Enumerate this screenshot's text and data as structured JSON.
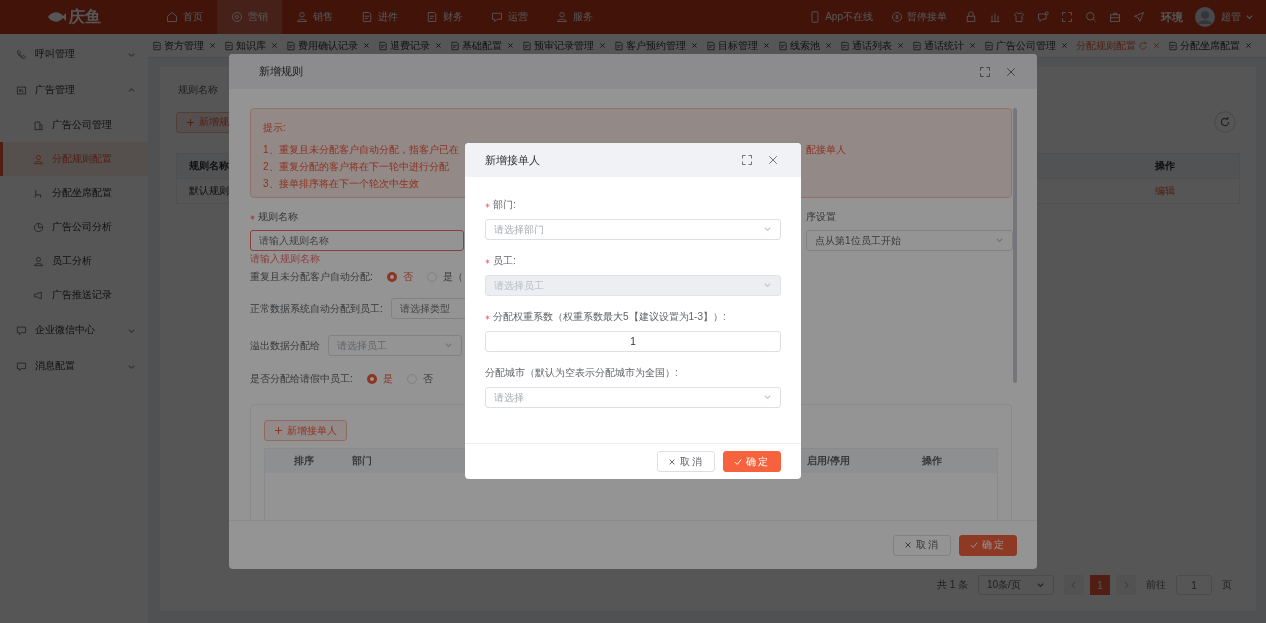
{
  "header": {
    "logo": "庆鱼",
    "nav": [
      {
        "label": "首页",
        "selected": false
      },
      {
        "label": "营销",
        "selected": true
      },
      {
        "label": "销售",
        "selected": false
      },
      {
        "label": "进件",
        "selected": false
      },
      {
        "label": "财务",
        "selected": false
      },
      {
        "label": "运营",
        "selected": false
      },
      {
        "label": "服务",
        "selected": false
      }
    ],
    "status": [
      "App不在线",
      "暂停接单"
    ],
    "env": "环境",
    "user": "超管"
  },
  "tabs": [
    {
      "label": "资方管理",
      "selected": false
    },
    {
      "label": "知识库",
      "selected": false
    },
    {
      "label": "费用确认记录",
      "selected": false
    },
    {
      "label": "退费记录",
      "selected": false
    },
    {
      "label": "基础配置",
      "selected": false
    },
    {
      "label": "预审记录管理",
      "selected": false
    },
    {
      "label": "客户预约管理",
      "selected": false
    },
    {
      "label": "目标管理",
      "selected": false
    },
    {
      "label": "线索池",
      "selected": false
    },
    {
      "label": "通话列表",
      "selected": false
    },
    {
      "label": "通话统计",
      "selected": false
    },
    {
      "label": "广告公司管理",
      "selected": false
    },
    {
      "label": "分配规则配置",
      "selected": true
    },
    {
      "label": "分配坐席配置",
      "selected": false
    }
  ],
  "sidebar": {
    "items": [
      {
        "label": "呼叫管理",
        "expanded": false
      },
      {
        "label": "广告管理",
        "expanded": true,
        "children": [
          {
            "label": "广告公司管理",
            "selected": false
          },
          {
            "label": "分配规则配置",
            "selected": true
          },
          {
            "label": "分配坐席配置",
            "selected": false
          },
          {
            "label": "广告公司分析",
            "selected": false
          },
          {
            "label": "员工分析",
            "selected": false
          },
          {
            "label": "广告推送记录",
            "selected": false
          }
        ]
      },
      {
        "label": "企业微信中心",
        "expanded": false
      },
      {
        "label": "消息配置",
        "expanded": false
      }
    ]
  },
  "page": {
    "filter_label": "规则名称",
    "add_button": "新增规",
    "table": {
      "columns": [
        "规则名称",
        "操作"
      ],
      "rows": [
        {
          "cells": [
            "默认规则",
            "编辑"
          ]
        }
      ]
    },
    "pagination": {
      "total": "共 1 条",
      "page_size": "10条/页",
      "pages": [
        {
          "label": "1",
          "selected": true
        }
      ],
      "jump_label": "前往",
      "jump_value": "1",
      "unit": "页"
    }
  },
  "rule_dialog": {
    "title": "新增规则",
    "tip": {
      "title": "提示:",
      "lines": [
        "1、重复且未分配客户自动分配，指客户已在",
        "2、重复分配的客户将在下一轮中进行分配",
        "3、接单排序将在下一个轮次中生效"
      ],
      "line_1_tail": "配接单人"
    },
    "rule_name": {
      "label": "规则名称",
      "required": true,
      "placeholder": "请输入规则名称",
      "error": "请输入规则名称"
    },
    "order": {
      "label": "序设置",
      "value": "点从第1位员工开始"
    },
    "repeat": {
      "label": "重复且未分配客户自动分配:",
      "options": [
        {
          "label": "否",
          "selected": true
        },
        {
          "label": "是（",
          "selected": false
        }
      ]
    },
    "normal": {
      "label": "正常数据系统自动分配到员工:",
      "placeholder": "请选择类型"
    },
    "overflow": {
      "label": "溢出数据分配给",
      "placeholder": "请选择员工"
    },
    "leave": {
      "label": "是否分配给请假中员工:",
      "options": [
        {
          "label": "是",
          "selected": true
        },
        {
          "label": "否",
          "selected": false
        }
      ]
    },
    "receivers": {
      "add_button": "新增接单人",
      "columns": [
        "排序",
        "部门",
        "启用/停用",
        "操作"
      ]
    },
    "buttons": [
      "取消",
      "确定"
    ]
  },
  "receiver_dialog": {
    "title": "新增接单人",
    "fields": [
      {
        "kind": "select",
        "label": "部门:",
        "required": true,
        "placeholder": "请选择部门",
        "disabled": false
      },
      {
        "kind": "select",
        "label": "员工:",
        "required": true,
        "placeholder": "请选择员工",
        "disabled": true
      },
      {
        "kind": "number",
        "label": "分配权重系数（权重系数最大5【建议设置为1-3】）:",
        "required": true,
        "value": "1"
      },
      {
        "kind": "select",
        "label": "分配城市（默认为空表示分配城市为全国）:",
        "required": false,
        "placeholder": "请选择",
        "disabled": false
      }
    ],
    "buttons": [
      "取消",
      "确定"
    ]
  }
}
